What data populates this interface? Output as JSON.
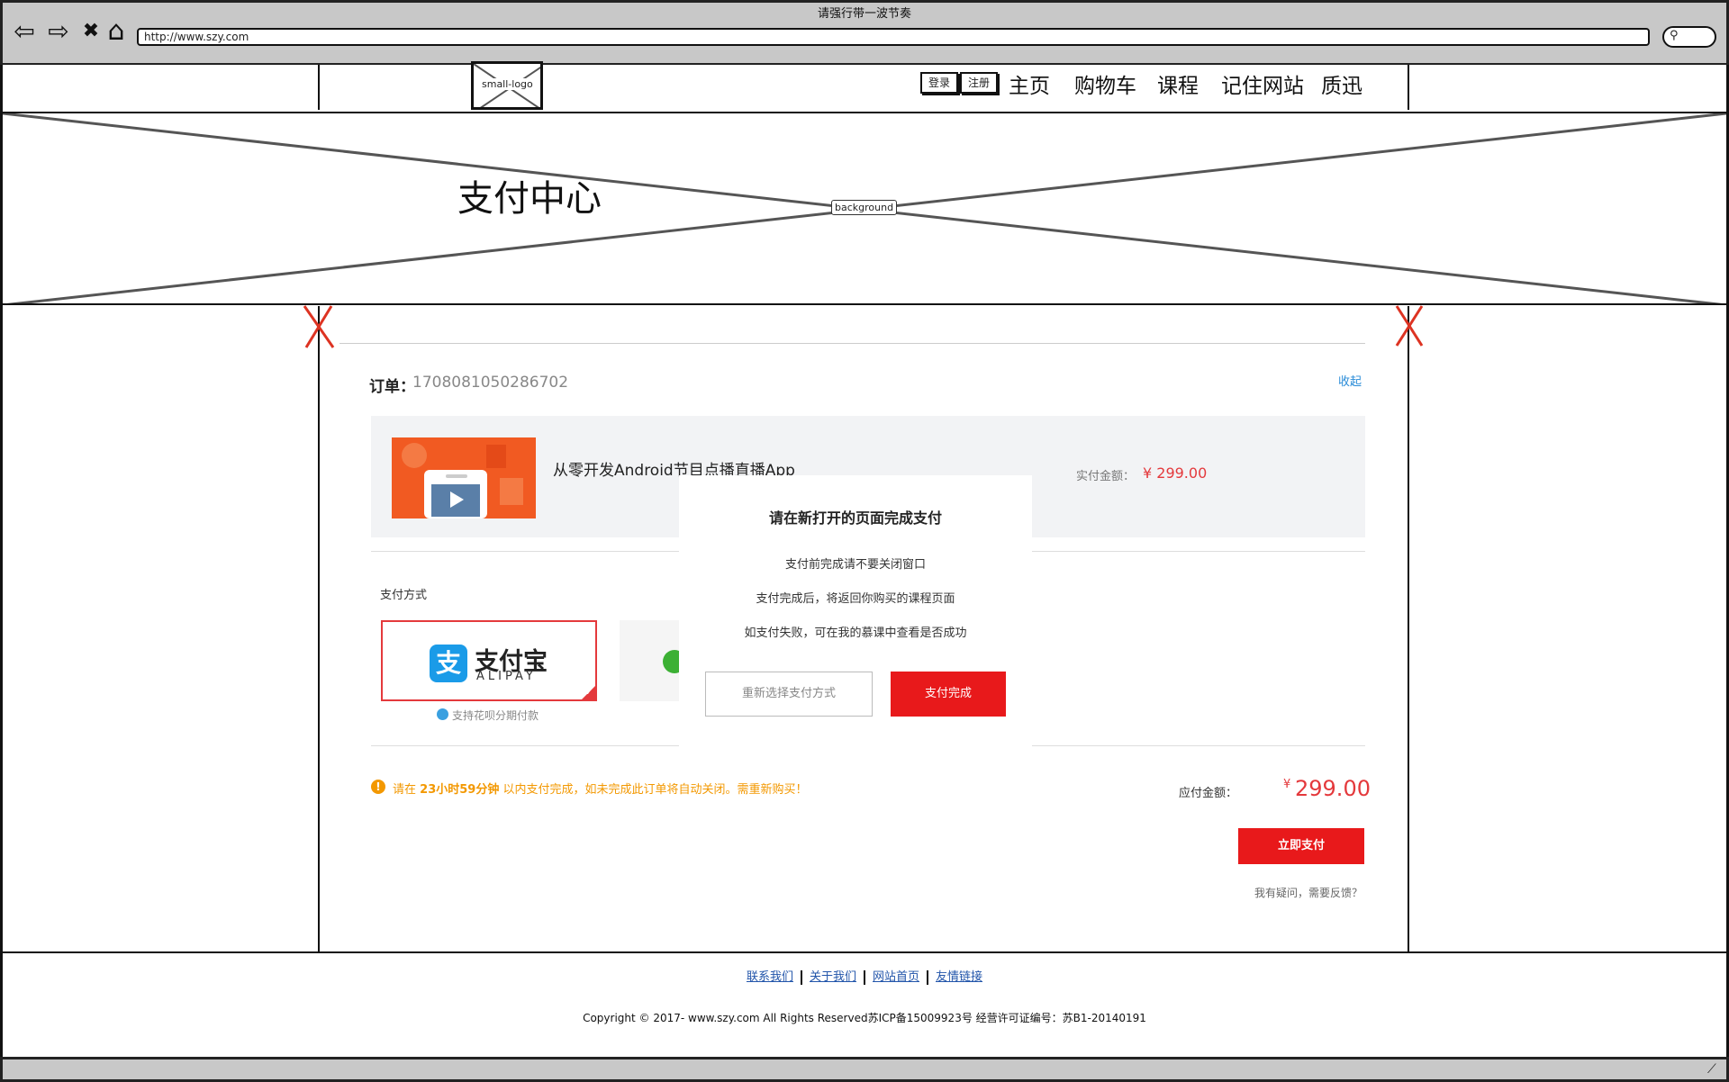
{
  "browser": {
    "title": "请强行带一波节奏",
    "url": "http://www.szy.com",
    "back_icon": "⇦",
    "forward_icon": "⇨",
    "stop_icon": "✖",
    "home_icon": "⌂",
    "search_icon": "⚲"
  },
  "header": {
    "logo_label": "small-logo",
    "login": "登录",
    "register": "注册",
    "nav": [
      "主页",
      "购物车",
      "课程",
      "记住网站",
      "质迅"
    ]
  },
  "banner": {
    "title": "支付中心",
    "image_label": "background"
  },
  "order": {
    "label": "订单：",
    "number": "1708081050286702",
    "collapse": "收起",
    "product_name": "从零开发Android节目点播直播App",
    "paid_label": "实付金额：",
    "paid_value": "¥ 299.00"
  },
  "payment": {
    "method_label": "支付方式",
    "alipay_cn": "支付宝",
    "alipay_en": "ALIPAY",
    "huabei": "支持花呗分期付款"
  },
  "summary": {
    "warn_prefix": "请在",
    "warn_time": "23小时59分钟",
    "warn_suffix": "以内支付完成，如未完成此订单将自动关闭。需重新购买！",
    "due_label": "应付金额：",
    "due_yen": "¥",
    "due_value": "299.00",
    "pay_now": "立即支付",
    "feedback": "我有疑问，需要反馈？"
  },
  "modal": {
    "title": "请在新打开的页面完成支付",
    "line1": "支付前完成请不要关闭窗口",
    "line2": "支付完成后，将返回你购买的课程页面",
    "line3": "如支付失败，可在我的慕课中查看是否成功",
    "reselect": "重新选择支付方式",
    "done": "支付完成"
  },
  "footer": {
    "links": [
      "联系我们",
      "关于我们",
      "网站首页",
      "友情链接"
    ],
    "copyright": "Copyright © 2017- www.szy.com All Rights Reserved苏ICP备15009923号 经营许可证编号：苏B1-20140191"
  },
  "colors": {
    "accent_red": "#e8191b",
    "price_red": "#e4393c",
    "warn_orange": "#f39800",
    "link_blue": "#2a8cd8",
    "alipay_blue": "#1a9be8",
    "wechat_green": "#3cb034"
  }
}
